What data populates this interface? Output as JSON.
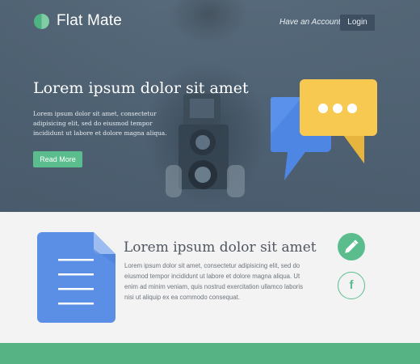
{
  "header": {
    "brand": "Flat Mate",
    "account_prompt": "Have an Account ?",
    "login_label": "Login"
  },
  "hero": {
    "title": "Lorem ipsum dolor sit amet",
    "text": "Lorem ipsum dolor sit amet, consectetur adipisicing elit, sed do eiusmod tempor incididunt ut labore et dolore magna aliqua.",
    "button_label": "Read More"
  },
  "feature": {
    "title": "Lorem ipsum dolor sit amet",
    "text": "Lorem ipsum dolor sit amet, consectetur adipisicing elit, sed do eiusmod tempor incididunt ut labore et dolore magna aliqua. Ut enim ad minim veniam, quis nostrud exercitation ullamco laboris nisi ut aliquip ex ea commodo consequat."
  },
  "social": {
    "facebook_glyph": "f"
  },
  "icons": {
    "logo": "logo-dot-icon",
    "chat": "chat-bubbles-icon",
    "document": "document-icon",
    "pencil": "pencil-icon",
    "facebook": "facebook-icon"
  },
  "colors": {
    "accent_green": "#5bbd8e",
    "hero_overlay": "#4f6273",
    "bubble_yellow": "#f7c951",
    "bubble_blue": "#4e86e4",
    "doc_blue": "#5b8fe6",
    "footer_green": "#56b384"
  }
}
